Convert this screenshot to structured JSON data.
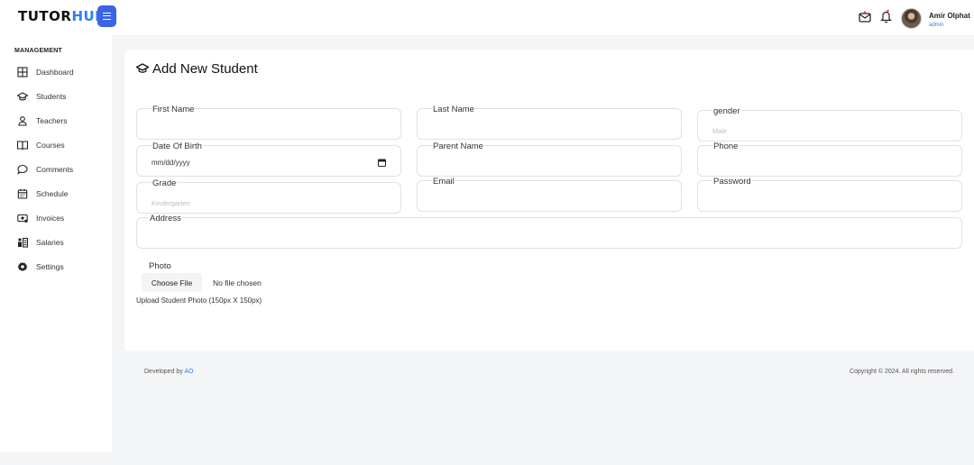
{
  "brand": {
    "logo_main": "TUTOR",
    "logo_accent": "HUB",
    "accent_color": "#2f7df6",
    "menu_button_color": "#3b63e6"
  },
  "header": {
    "icons": [
      "mail-icon",
      "bell-icon"
    ],
    "user": {
      "name": "Amir Olphat",
      "role": "admin"
    }
  },
  "sidebar": {
    "section_title": "MANAGEMENT",
    "items": [
      {
        "label": "Dashboard",
        "icon": "dashboard-icon"
      },
      {
        "label": "Students",
        "icon": "graduation-cap-icon"
      },
      {
        "label": "Teachers",
        "icon": "user-icon"
      },
      {
        "label": "Courses",
        "icon": "book-icon"
      },
      {
        "label": "Comments",
        "icon": "comment-icon"
      },
      {
        "label": "Schedule",
        "icon": "calendar-icon"
      },
      {
        "label": "Invoices",
        "icon": "invoice-icon"
      },
      {
        "label": "Salaries",
        "icon": "salary-icon"
      },
      {
        "label": "Settings",
        "icon": "gear-icon"
      }
    ]
  },
  "form": {
    "title": "Add New Student",
    "fields": {
      "first_name": {
        "label": "First Name",
        "placeholder": ""
      },
      "last_name": {
        "label": "Last Name",
        "placeholder": ""
      },
      "gender": {
        "label": "gender",
        "placeholder": "Male"
      },
      "dob": {
        "label": "Date Of Birth",
        "value": "mm/dd/yyyy"
      },
      "parent_name": {
        "label": "Parent Name",
        "placeholder": ""
      },
      "phone": {
        "label": "Phone",
        "placeholder": ""
      },
      "grade": {
        "label": "Grade",
        "placeholder": "Kindergarten"
      },
      "email": {
        "label": "Email",
        "placeholder": ""
      },
      "password": {
        "label": "Password",
        "placeholder": ""
      },
      "address": {
        "label": "Address",
        "placeholder": ""
      }
    },
    "photo": {
      "label": "Photo",
      "button_label": "Choose File",
      "status": "No file chosen",
      "help": "Upload Student Photo (150px X 150px)"
    }
  },
  "footer": {
    "developed_by": "Developed by",
    "developer": "AO",
    "copyright": "Copyright © 2024. All rights reserved."
  }
}
